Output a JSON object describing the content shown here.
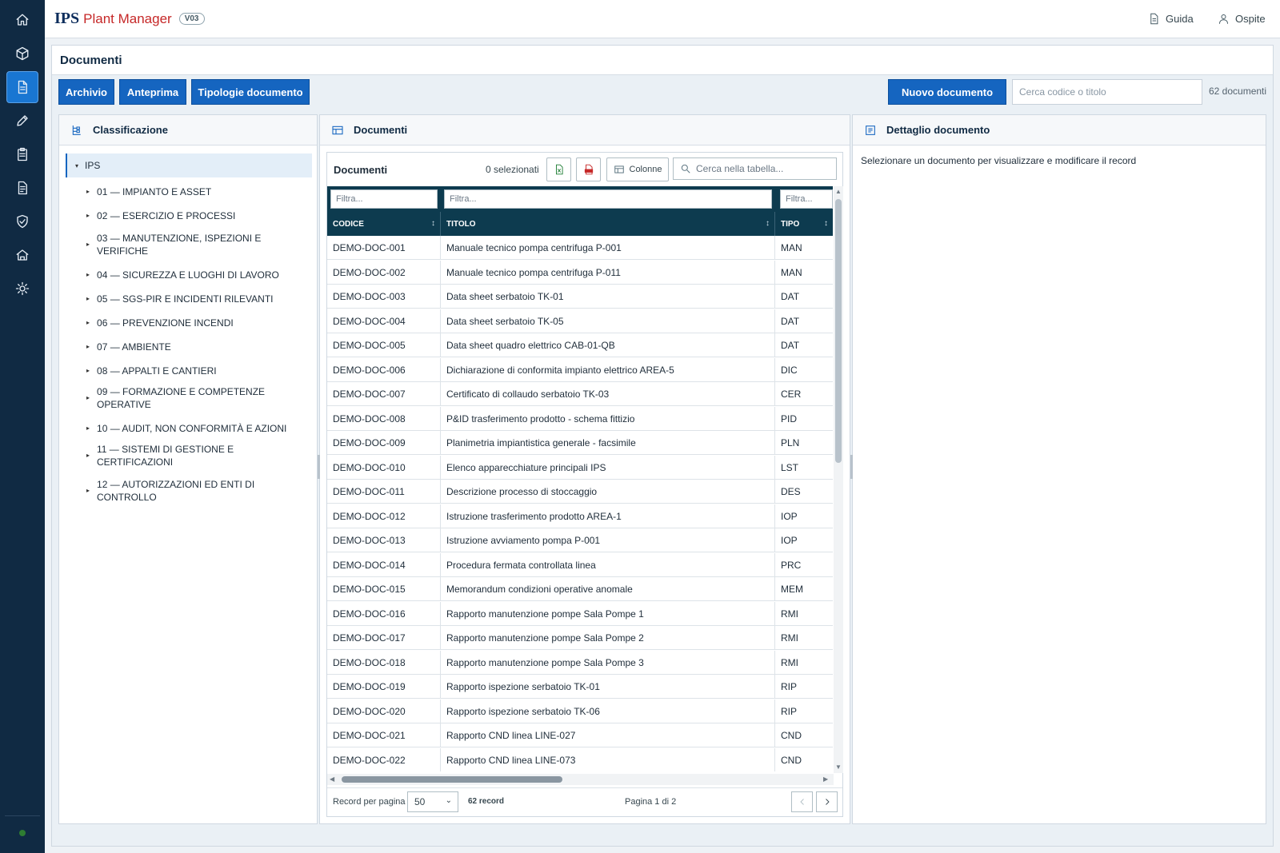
{
  "sidebar": {
    "items": [
      {
        "name": "home-icon",
        "active": false
      },
      {
        "name": "cube-icon",
        "active": false
      },
      {
        "name": "document-icon",
        "active": true
      },
      {
        "name": "pencil-icon",
        "active": false
      },
      {
        "name": "clipboard-icon",
        "active": false
      },
      {
        "name": "file-text-icon",
        "active": false
      },
      {
        "name": "shield-check-icon",
        "active": false
      },
      {
        "name": "building-icon",
        "active": false
      },
      {
        "name": "sun-icon",
        "active": false
      }
    ],
    "status_color": "#2e7d32"
  },
  "topbar": {
    "brand_ips": "IPS",
    "brand_name": "Plant Manager",
    "version": "V03",
    "guide_label": "Guida",
    "user_label": "Ospite"
  },
  "page": {
    "title": "Documenti",
    "tabs": [
      "Archivio",
      "Anteprima",
      "Tipologie documento"
    ],
    "new_button": "Nuovo documento",
    "search_placeholder": "Cerca codice o titolo",
    "doc_count": "62 documenti"
  },
  "classification": {
    "title": "Classificazione",
    "root": "IPS",
    "items": [
      [
        "01 — IMPIANTO E ASSET"
      ],
      [
        "02 — ESERCIZIO E PROCESSI"
      ],
      [
        "03 — MANUTENZIONE, ISPEZIONI E",
        "VERIFICHE"
      ],
      [
        "04 — SICUREZZA E LUOGHI DI LAVORO"
      ],
      [
        "05 — SGS-PIR E INCIDENTI RILEVANTI"
      ],
      [
        "06 — PREVENZIONE INCENDI"
      ],
      [
        "07 — AMBIENTE"
      ],
      [
        "08 — APPALTI E CANTIERI"
      ],
      [
        "09 — FORMAZIONE E COMPETENZE",
        "OPERATIVE"
      ],
      [
        "10 — AUDIT, NON CONFORMITÀ E AZIONI"
      ],
      [
        "11 — SISTEMI DI GESTIONE E",
        "CERTIFICAZIONI"
      ],
      [
        "12 — AUTORIZZAZIONI ED ENTI DI",
        "CONTROLLO"
      ]
    ]
  },
  "documents": {
    "panel_title": "Documenti",
    "grid_title": "Documenti",
    "selected": "0 selezionati",
    "columns_button": "Colonne",
    "table_search_placeholder": "Cerca nella tabella...",
    "filter_placeholder": "Filtra...",
    "headers": [
      "CODICE",
      "TITOLO",
      "TIPO"
    ],
    "rows": [
      [
        "DEMO-DOC-001",
        "Manuale tecnico pompa centrifuga P-001",
        "MAN"
      ],
      [
        "DEMO-DOC-002",
        "Manuale tecnico pompa centrifuga P-011",
        "MAN"
      ],
      [
        "DEMO-DOC-003",
        "Data sheet serbatoio TK-01",
        "DAT"
      ],
      [
        "DEMO-DOC-004",
        "Data sheet serbatoio TK-05",
        "DAT"
      ],
      [
        "DEMO-DOC-005",
        "Data sheet quadro elettrico CAB-01-QB",
        "DAT"
      ],
      [
        "DEMO-DOC-006",
        "Dichiarazione di conformita impianto elettrico AREA-5",
        "DIC"
      ],
      [
        "DEMO-DOC-007",
        "Certificato di collaudo serbatoio TK-03",
        "CER"
      ],
      [
        "DEMO-DOC-008",
        "P&ID trasferimento prodotto - schema fittizio",
        "PID"
      ],
      [
        "DEMO-DOC-009",
        "Planimetria impiantistica generale - facsimile",
        "PLN"
      ],
      [
        "DEMO-DOC-010",
        "Elenco apparecchiature principali IPS",
        "LST"
      ],
      [
        "DEMO-DOC-011",
        "Descrizione processo di stoccaggio",
        "DES"
      ],
      [
        "DEMO-DOC-012",
        "Istruzione trasferimento prodotto AREA-1",
        "IOP"
      ],
      [
        "DEMO-DOC-013",
        "Istruzione avviamento pompa P-001",
        "IOP"
      ],
      [
        "DEMO-DOC-014",
        "Procedura fermata controllata linea",
        "PRC"
      ],
      [
        "DEMO-DOC-015",
        "Memorandum condizioni operative anomale",
        "MEM"
      ],
      [
        "DEMO-DOC-016",
        "Rapporto manutenzione pompe Sala Pompe 1",
        "RMI"
      ],
      [
        "DEMO-DOC-017",
        "Rapporto manutenzione pompe Sala Pompe 2",
        "RMI"
      ],
      [
        "DEMO-DOC-018",
        "Rapporto manutenzione pompe Sala Pompe 3",
        "RMI"
      ],
      [
        "DEMO-DOC-019",
        "Rapporto ispezione serbatoio TK-01",
        "RIP"
      ],
      [
        "DEMO-DOC-020",
        "Rapporto ispezione serbatoio TK-06",
        "RIP"
      ],
      [
        "DEMO-DOC-021",
        "Rapporto CND linea LINE-027",
        "CND"
      ],
      [
        "DEMO-DOC-022",
        "Rapporto CND linea LINE-073",
        "CND"
      ]
    ],
    "footer": {
      "per_page_label": "Record per pagina",
      "per_page_value": "50",
      "record_count": "62 record",
      "page_info": "Pagina 1 di 2"
    }
  },
  "detail": {
    "title": "Dettaglio documento",
    "message": "Selezionare un documento per visualizzare e modificare il record"
  }
}
